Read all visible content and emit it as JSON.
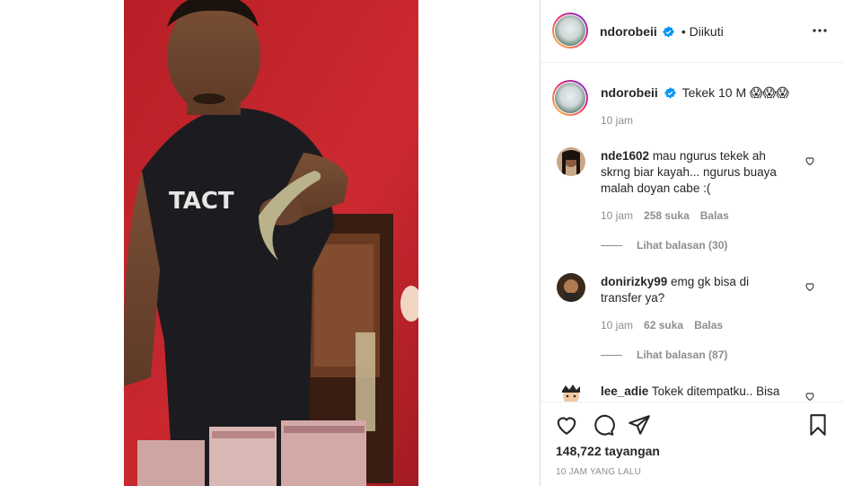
{
  "post": {
    "username": "ndorobeii",
    "follow_status": "Diikuti",
    "separator": "•",
    "more_icon": "more-horizontal-icon",
    "caption_text": "Tekek 10 M 😱😱😱",
    "caption_time": "10 jam"
  },
  "comments": [
    {
      "username": "nde1602",
      "text": "mau ngurus tekek ah skrng biar kayah... ngurus buaya malah doyan cabe :(",
      "time": "10 jam",
      "likes": "258 suka",
      "reply": "Balas",
      "view_replies": "Lihat balasan (30)"
    },
    {
      "username": "donirizky99",
      "text": "emg gk bisa di transfer ya?",
      "time": "10 jam",
      "likes": "62 suka",
      "reply": "Balas",
      "view_replies": "Lihat balasan (87)"
    },
    {
      "username": "lee_adie",
      "text": "Tokek ditempatku.. Bisa"
    }
  ],
  "footer": {
    "views": "148,722 tayangan",
    "time_ago": "10 JAM YANG LALU"
  },
  "colors": {
    "accent": "#0095f6",
    "text": "#262626",
    "muted": "#8e8e8e",
    "video_wall": "#c0232a"
  }
}
